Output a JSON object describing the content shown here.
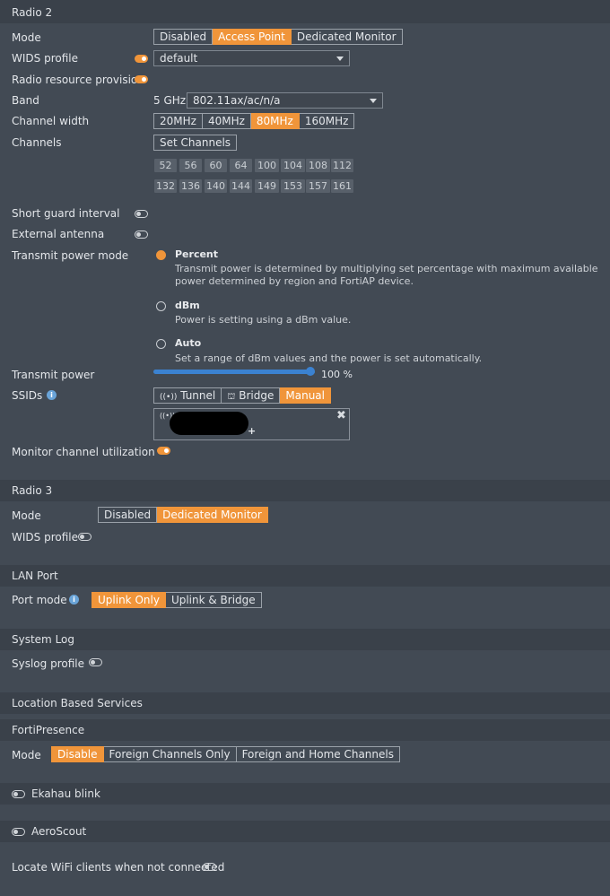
{
  "radio2": {
    "title": "Radio 2",
    "mode_label": "Mode",
    "mode_options": [
      "Disabled",
      "Access Point",
      "Dedicated Monitor"
    ],
    "mode_selected": "Access Point",
    "wids_label": "WIDS profile",
    "wids_value": "default",
    "rrp_label": "Radio resource provision",
    "band_label": "Band",
    "band_prefix": "5 GHz",
    "band_value": "802.11ax/ac/n/a",
    "width_label": "Channel width",
    "width_options": [
      "20MHz",
      "40MHz",
      "80MHz",
      "160MHz"
    ],
    "width_selected": "80MHz",
    "channels_label": "Channels",
    "set_channels": "Set Channels",
    "channels_row1": [
      "52",
      "56",
      "60",
      "64",
      "100",
      "104",
      "108",
      "112"
    ],
    "channels_row2": [
      "132",
      "136",
      "140",
      "144",
      "149",
      "153",
      "157",
      "161"
    ],
    "sgi_label": "Short guard interval",
    "ext_antenna_label": "External antenna",
    "tpm_label": "Transmit power mode",
    "tpm_percent_title": "Percent",
    "tpm_percent_desc1": "Transmit power is determined by multiplying set percentage with maximum available",
    "tpm_percent_desc2": "power determined by region and FortiAP device.",
    "tpm_dbm_title": "dBm",
    "tpm_dbm_desc": "Power is setting using a dBm value.",
    "tpm_auto_title": "Auto",
    "tpm_auto_desc": "Set a range of dBm values and the power is set automatically.",
    "tp_label": "Transmit power",
    "tp_value": "100 %",
    "tp_fraction": 1.0,
    "ssids_label": "SSIDs",
    "ssid_options": [
      "Tunnel",
      "Bridge",
      "Manual"
    ],
    "ssid_selected": "Manual",
    "add_symbol": "+",
    "monitor_label": "Monitor channel utilization"
  },
  "radio3": {
    "title": "Radio 3",
    "mode_label": "Mode",
    "mode_options": [
      "Disabled",
      "Dedicated Monitor"
    ],
    "mode_selected": "Dedicated Monitor",
    "wids_label": "WIDS profile"
  },
  "lan": {
    "title": "LAN Port",
    "port_mode_label": "Port mode",
    "options": [
      "Uplink Only",
      "Uplink & Bridge"
    ],
    "selected": "Uplink Only"
  },
  "syslog": {
    "title": "System Log",
    "profile_label": "Syslog profile"
  },
  "lbs": {
    "title": "Location Based Services"
  },
  "fortipresence": {
    "title": "FortiPresence",
    "mode_label": "Mode",
    "options": [
      "Disable",
      "Foreign Channels Only",
      "Foreign and Home Channels"
    ],
    "selected": "Disable"
  },
  "ekahau": {
    "label": "Ekahau blink"
  },
  "aeroscout": {
    "label": "AeroScout"
  },
  "locate": {
    "label": "Locate WiFi clients when not connected"
  },
  "colors": {
    "accent": "#f0953a",
    "background": "#424a54",
    "section": "#3a414a"
  }
}
